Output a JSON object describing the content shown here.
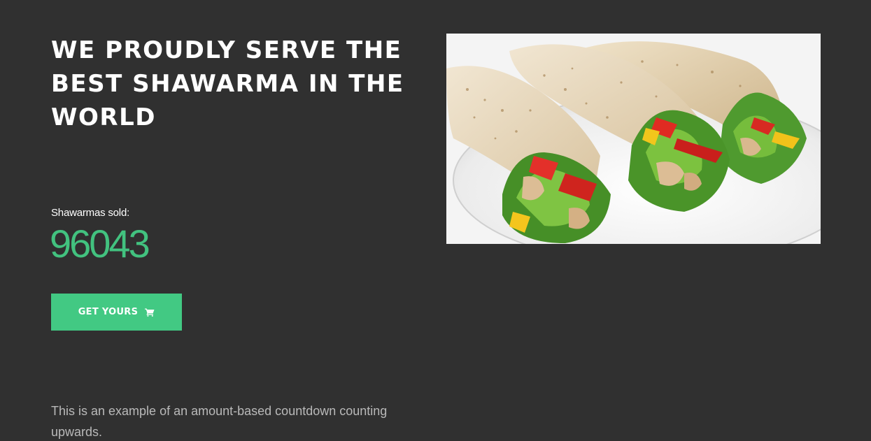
{
  "hero": {
    "headline": "WE PROUDLY SERVE THE BEST SHAWARMA IN THE WORLD",
    "counter_label": "Shawarmas sold:",
    "counter_value": "96043",
    "cta_label": "GET YOURS",
    "cta_icon": "shopping-cart-icon",
    "description": "This is an example of an amount-based countdown counting upwards.",
    "image_subject": "shawarma-wraps-photo"
  },
  "colors": {
    "background": "#303030",
    "accent": "#42c983",
    "counter": "#42c27f",
    "heading": "#ffffff",
    "description": "#b9b9b9"
  }
}
